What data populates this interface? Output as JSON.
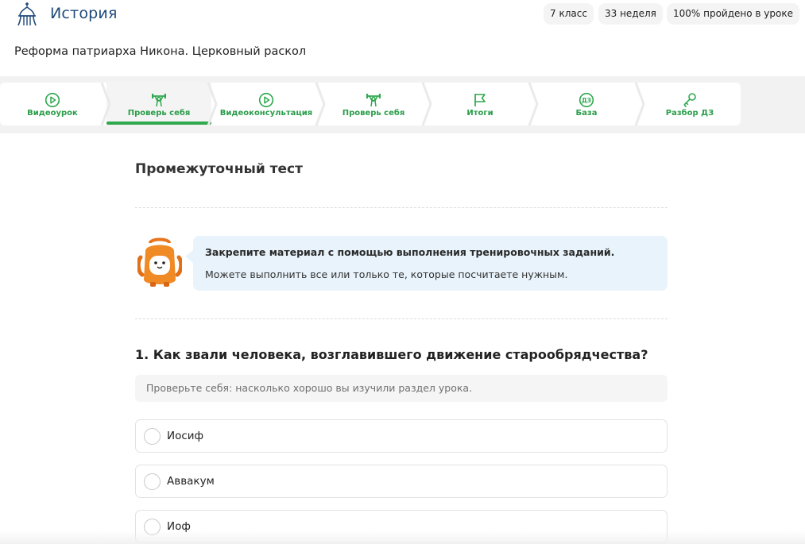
{
  "header": {
    "subject": "История",
    "chips": [
      "7 класс",
      "33 неделя",
      "100% пройдено в уроке"
    ]
  },
  "lesson": {
    "title": "Реформа патриарха Никона. Церковный раскол"
  },
  "tabs": [
    {
      "label": "Видеоурок",
      "icon": "play-circle-icon",
      "active": false
    },
    {
      "label": "Проверь себя",
      "icon": "weightlifter-icon",
      "active": true
    },
    {
      "label": "Видеоконсультация",
      "icon": "play-circle-icon",
      "active": false
    },
    {
      "label": "Проверь себя",
      "icon": "weightlifter-icon",
      "active": false
    },
    {
      "label": "Итоги",
      "icon": "flag-icon",
      "active": false
    },
    {
      "label": "База",
      "icon": "dz-badge-icon",
      "active": false
    },
    {
      "label": "Разбор ДЗ",
      "icon": "key-icon",
      "active": false
    }
  ],
  "test": {
    "title": "Промежуточный тест",
    "tip_line1": "Закрепите материал с помощью выполнения тренировочных заданий.",
    "tip_line2": "Можете выполнить все или только те, которые посчитаете нужным.",
    "question": "1. Как звали человека, возглавившего движение старообрядчества?",
    "hint": "Проверьте себя: насколько хорошо вы изучили раздел урока.",
    "options": [
      "Иосиф",
      "Аввакум",
      "Иоф"
    ]
  },
  "colors": {
    "accent_green": "#2fa84f",
    "brand_blue": "#1f4a7a",
    "tip_bg": "#e8f3fb"
  }
}
